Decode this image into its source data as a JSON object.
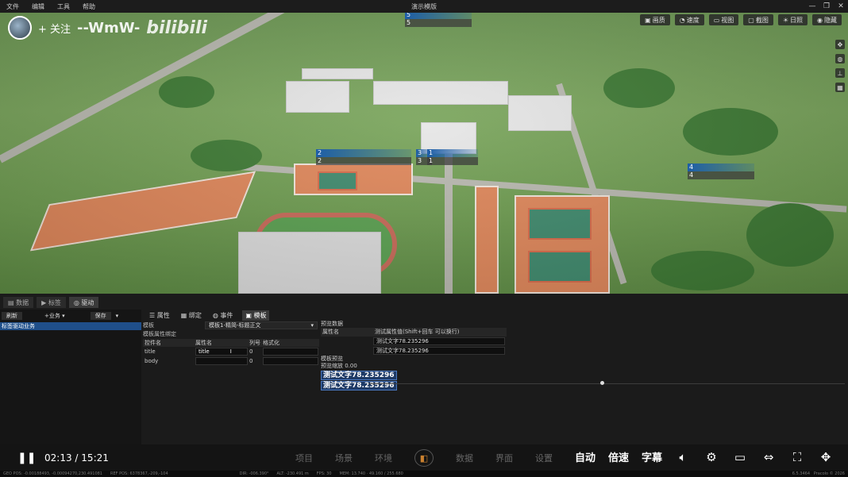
{
  "menubar": {
    "items": [
      "文件",
      "编辑",
      "工具",
      "帮助"
    ],
    "title": "演示模版"
  },
  "overlay": {
    "follow": "+ 关注",
    "uploader": "--WmW-",
    "logo": "bilibili"
  },
  "viewport_toolbar": [
    {
      "icon": "image-quality-icon",
      "label": "画质"
    },
    {
      "icon": "speed-icon",
      "label": "速度"
    },
    {
      "icon": "view-icon",
      "label": "视图"
    },
    {
      "icon": "screenshot-icon",
      "label": "截图"
    },
    {
      "icon": "sun-icon",
      "label": "日照"
    },
    {
      "icon": "eye-icon",
      "label": "隐藏"
    }
  ],
  "markers": [
    {
      "id": "marker-5",
      "top": "5",
      "bottom": "5"
    },
    {
      "id": "marker-2",
      "top": "2",
      "bottom": "2"
    },
    {
      "id": "marker-3",
      "top": "3",
      "bottom": "3"
    },
    {
      "id": "marker-1",
      "top": "1",
      "bottom": "1"
    },
    {
      "id": "marker-4",
      "top": "4",
      "bottom": "4"
    }
  ],
  "panel": {
    "tabs": [
      "数据",
      "标签",
      "驱动"
    ],
    "left": {
      "refresh": "刷新",
      "business": "+业务",
      "save": "保存",
      "tree_item": "标签驱动业务"
    },
    "mid_tabs": [
      "属性",
      "绑定",
      "事件",
      "模板"
    ],
    "template_label": "模板",
    "template_value": "模板1-精简-标题正文",
    "binding_label": "模板属性绑定",
    "grid_headers": [
      "控件名",
      "属性名",
      "列号",
      "格式化"
    ],
    "grid_rows": [
      {
        "control": "title",
        "prop": "title",
        "col": "0",
        "fmt": ""
      },
      {
        "control": "body",
        "prop": "",
        "col": "0",
        "fmt": ""
      }
    ],
    "preview_data_label": "预览数据",
    "preview_headers": [
      "属性名",
      "测试属性值(Shift+回车 可以换行)"
    ],
    "preview_rows": [
      "测试文字78.235296",
      "测试文字78.235296"
    ],
    "template_preview_label": "模板预览",
    "preview_scale": "预览缩放 0.00",
    "preview_labels": [
      "测试文字78.235296",
      "测试文字78.235296"
    ]
  },
  "player": {
    "current": "02:13",
    "sep": "/",
    "total": "15:21",
    "nav": [
      "项目",
      "场景",
      "环境",
      "数据",
      "界面",
      "设置"
    ],
    "auto": "自动",
    "speed": "倍速",
    "subtitle": "字幕"
  },
  "statusbar": {
    "geo": "GEO POS: -0.00188493, -0.00094270,230.491081",
    "ref": "REF POS: 6378367,-209,-104",
    "dir": "DIR: -006.390°",
    "alt": "ALT: -230.491 m",
    "fps": "FPS: 30",
    "mem": "MEM: 13.740 · 49.160 / 255.680",
    "version": "6.5.3464",
    "copyright": "Pracolo © 2026"
  }
}
